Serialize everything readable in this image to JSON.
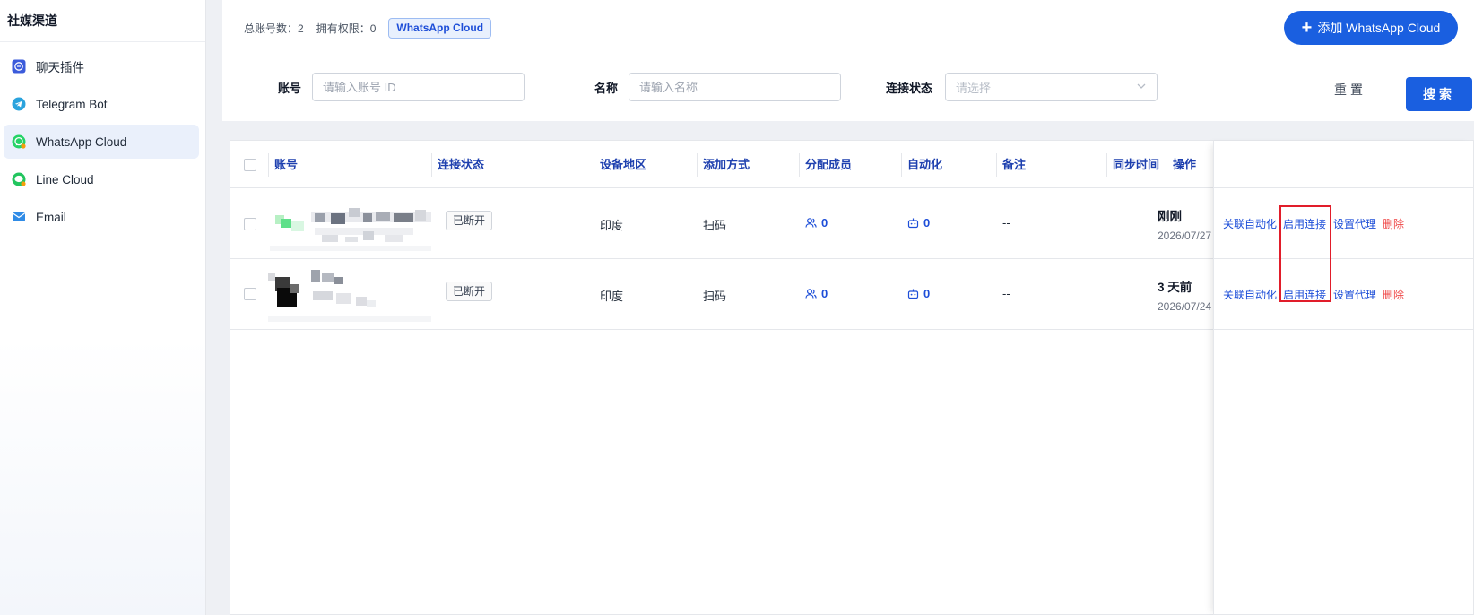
{
  "sidebar": {
    "title": "社媒渠道",
    "items": [
      {
        "label": "聊天插件",
        "icon": "chat-plugin-icon",
        "color": "#3b5bdb"
      },
      {
        "label": "Telegram Bot",
        "icon": "telegram-icon",
        "color": "#2aa3dd"
      },
      {
        "label": "WhatsApp Cloud",
        "icon": "whatsapp-icon",
        "color": "#25d366",
        "active": true
      },
      {
        "label": "Line Cloud",
        "icon": "line-icon",
        "color": "#22c55e"
      },
      {
        "label": "Email",
        "icon": "email-icon",
        "color": "#2f8be6"
      }
    ]
  },
  "header": {
    "total_accounts": "总账号数：2",
    "permissions": "拥有权限：0",
    "channel_tag": "WhatsApp Cloud",
    "add_button": "添加 WhatsApp Cloud"
  },
  "filters": {
    "account_label": "账号",
    "account_placeholder": "请输入账号 ID",
    "name_label": "名称",
    "name_placeholder": "请输入名称",
    "status_label": "连接状态",
    "status_placeholder": "请选择",
    "reset": "重置",
    "search": "搜索"
  },
  "table": {
    "columns": [
      "账号",
      "连接状态",
      "设备地区",
      "添加方式",
      "分配成员",
      "自动化",
      "备注",
      "同步时间",
      "操作"
    ],
    "rows": [
      {
        "status": "已断开",
        "region": "印度",
        "method": "扫码",
        "members": "0",
        "automation": "0",
        "remark": "--",
        "sync_relative": "刚刚",
        "sync_date": "2026/07/27"
      },
      {
        "status": "已断开",
        "region": "印度",
        "method": "扫码",
        "members": "0",
        "automation": "0",
        "remark": "--",
        "sync_relative": "3 天前",
        "sync_date": "2026/07/24"
      }
    ],
    "actions": {
      "link_automation": "关联自动化",
      "enable": "启用连接",
      "proxy": "设置代理",
      "delete": "删除"
    }
  },
  "colors": {
    "primary": "#1a5fe0",
    "danger": "#ef4444",
    "highlight": "#e11d2a"
  }
}
